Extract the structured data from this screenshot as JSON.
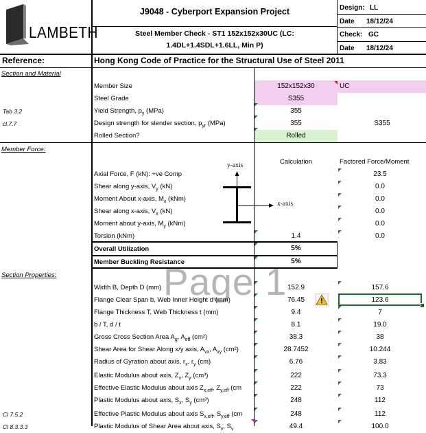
{
  "logo": {
    "text": "LAMBETH"
  },
  "header": {
    "project": "J9048 - Cyberport Expansion Project",
    "check_line1": "Steel Member Check - ST1 152x152x30UC (LC:",
    "check_line2": "1.4DL+1.4SDL+1.6LL, Min P)",
    "design_label": "Design:",
    "design_value": "LL",
    "date_label1": "Date",
    "date_value1": "18/12/24",
    "check_label": "Check:",
    "check_value": "GC",
    "date_label2": "Date",
    "date_value2": "18/12/24"
  },
  "reference": {
    "label": "Reference:",
    "code": "Hong Kong Code of Practice for the Structural Use of Steel 2011"
  },
  "section_material": {
    "title": "Section and Material",
    "rows": [
      {
        "label": "Member Size",
        "calc": "152x152x30",
        "right": "UC"
      },
      {
        "label": "Steel Grade",
        "calc": "S355",
        "right": ""
      },
      {
        "ref": "Tab 3.2",
        "label": "Yield Strength, p",
        "sub": "y",
        "tail": " (MPa)",
        "calc": "355",
        "right": ""
      },
      {
        "ref": "cl.7.7",
        "label": "Design strength for slender section, p",
        "sub": "yr",
        "tail": " (MPa)",
        "calc": "355",
        "right": "S355"
      },
      {
        "label": "Rolled Section?",
        "calc": "Rolled",
        "right": ""
      }
    ]
  },
  "member_force": {
    "title": "Member Force:",
    "col_calc": "Calculation",
    "col_factored": "Factored Force/Moment",
    "axis_y": "y-axis",
    "axis_x": "x-axis",
    "rows": [
      {
        "label": "Axial Force, F (kN): +ve Comp",
        "calc": "",
        "factored": "23.5"
      },
      {
        "label": "Shear along y-axis, V",
        "sub": "y",
        "tail": " (kN)",
        "calc": "",
        "factored": "0.0"
      },
      {
        "label": "Moment About x-axis, M",
        "sub": "x",
        "tail": " (kNm)",
        "calc": "",
        "factored": "0.0"
      },
      {
        "label": "Shear along x-axis, V",
        "sub": "x",
        "tail": " (kN)",
        "calc": "",
        "factored": "0.0"
      },
      {
        "label": "Moment about y-axis, M",
        "sub": "y",
        "tail": " (kNm)",
        "calc": "",
        "factored": "0.0"
      },
      {
        "label": "Torsion (kNm)",
        "calc": "1.4",
        "factored": "0.0"
      }
    ],
    "overall_label": "Overall Utilization",
    "overall_value": "5%",
    "buckling_label": "Member Buckling Resistance",
    "buckling_value": "5%"
  },
  "section_properties": {
    "title": "Section Properties:",
    "watermark": "Page 1",
    "rows": [
      {
        "label": "Width B, Depth D (mm)",
        "calc": "152.9",
        "right": "157.6"
      },
      {
        "label": "Flange Clear Span b, Web Inner Height d (mm)",
        "calc": "76.45",
        "right": "123.6",
        "warn": true
      },
      {
        "label": "Flange Thickness T, Web Thickness t (mm)",
        "calc": "9.4",
        "right": "7"
      },
      {
        "label": "b / T, d / t",
        "calc": "8.1",
        "right": "19.0"
      },
      {
        "label": "Gross Cross Section Area A",
        "sub": "g",
        "tail": ", A",
        "sub2": "eff",
        "tail2": " (cm²)",
        "calc": "38.3",
        "right": "38"
      },
      {
        "label": "Shear Area for Shear Along x/y axis, A",
        "sub": "vx",
        "tail": ", A",
        "sub2": "vy",
        "tail2": " (cm²)",
        "calc": "28.7452",
        "right": "10.244"
      },
      {
        "label": "Radius of Gyration about axis, r",
        "sub": "x",
        "tail": ", r",
        "sub2": "y",
        "tail2": " (cm)",
        "calc": "6.76",
        "right": "3.83"
      },
      {
        "label": "Elastic Modulus about axis, Z",
        "sub": "x",
        "tail": ", Z",
        "sub2": "y",
        "tail2": " (cm³)",
        "calc": "222",
        "right": "73.3"
      },
      {
        "label": "Effective Elastic Modulus about axis Z",
        "sub": "x,eff",
        "tail": ", Z",
        "sub2": "y,eff",
        "tail2": " (cm",
        "calc": "222",
        "right": "73"
      },
      {
        "label": "Plastic Modulus about axis, S",
        "sub": "x",
        "tail": ", S",
        "sub2": "y",
        "tail2": " (cm³)",
        "calc": "248",
        "right": "112"
      },
      {
        "ref": "Cl 7.5.2",
        "label": "Effective Plastic Modulus about axis S",
        "sub": "x,eff",
        "tail": ", S",
        "sub2": "y,eff",
        "tail2": " (cm",
        "calc": "248",
        "right": "112"
      },
      {
        "ref": "Cl 8.3.3.3",
        "label": "Plastic Modulus of Shear Area about axis, S",
        "sub": "v",
        "tail": ", S",
        "sub2": "v",
        "tail2": "",
        "calc": "49.4",
        "right": "100.0"
      }
    ]
  }
}
